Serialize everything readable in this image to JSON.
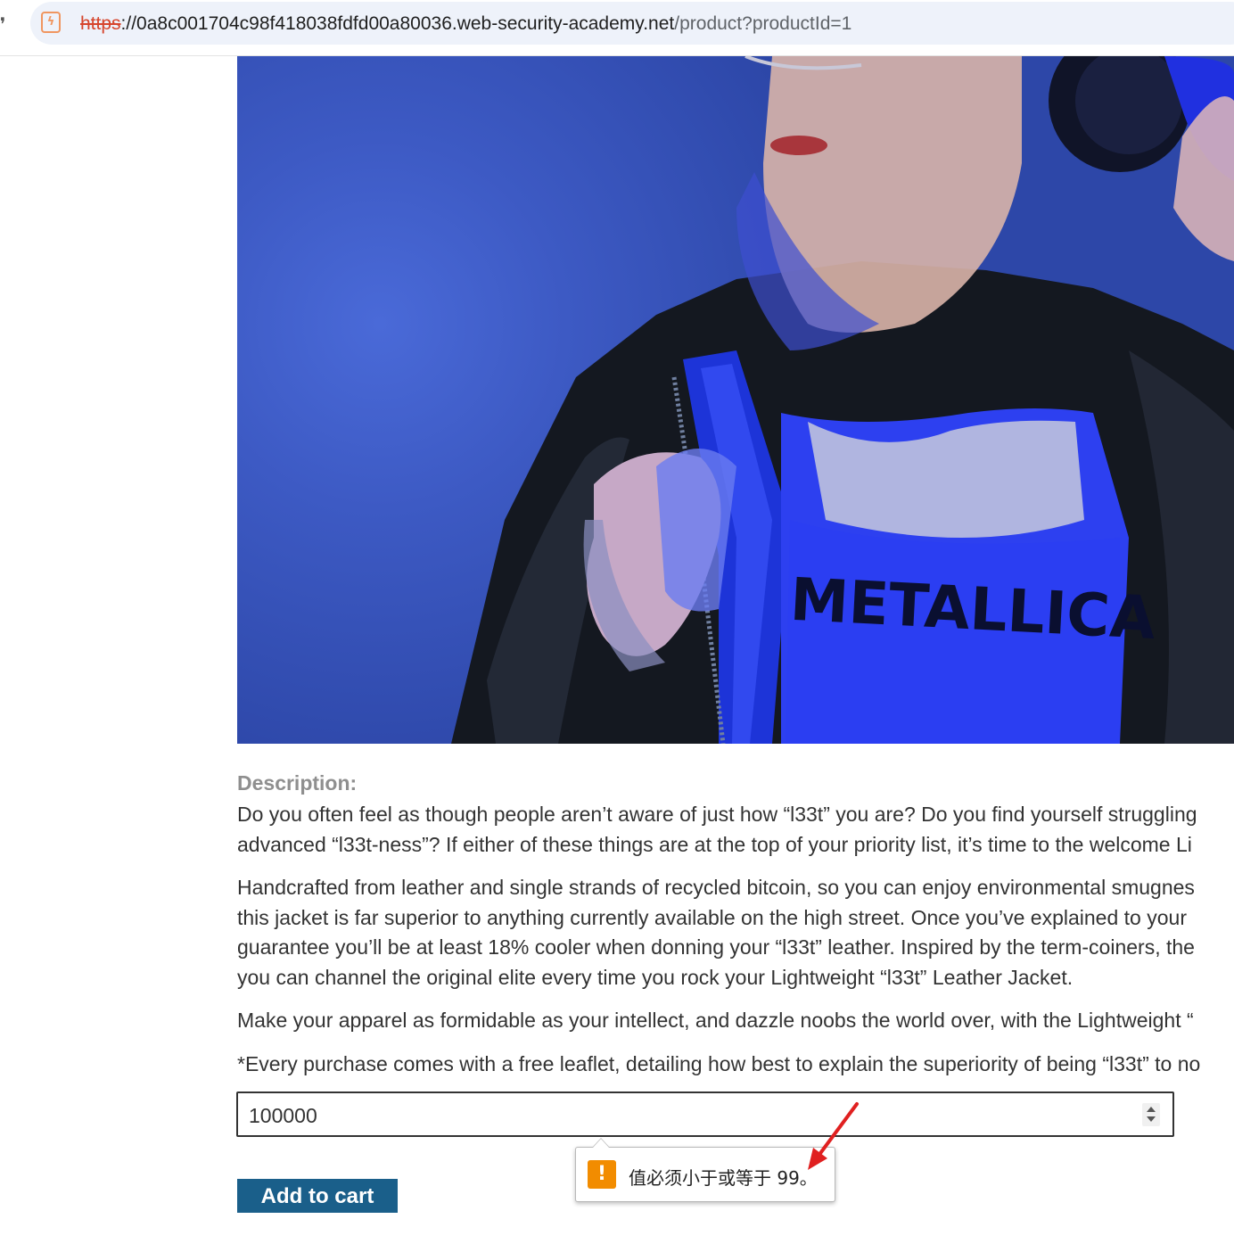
{
  "browser": {
    "url_scheme": "https",
    "url_host": "://0a8c001704c98f418038fdfd00a80036.web-security-academy.net",
    "url_path": "/product?productId=1",
    "site_icon": "not-secure-icon",
    "colors": {
      "scheme_warning": "#d6452c",
      "omnibox_bg": "#eef2fa"
    }
  },
  "product": {
    "image_tshirt_text": "METALLICA",
    "description_heading": "Description:",
    "description_paragraphs": [
      [
        "Do you often feel as though people aren’t aware of just how “l33t” you are? Do you find yourself struggling",
        "advanced “l33t-ness”? If either of these things are at the top of your priority list, it’s time to the welcome Li"
      ],
      [
        "Handcrafted from leather and single strands of recycled bitcoin, so you can enjoy environmental smugnes",
        "this jacket is far superior to anything currently available on the high street. Once you’ve explained to your",
        "guarantee you’ll be at least 18% cooler when donning your “l33t” leather. Inspired by the term-coiners, the",
        "you can channel the original elite every time you rock your Lightweight “l33t” Leather Jacket."
      ],
      [
        "Make your apparel as formidable as your intellect, and dazzle noobs the world over, with the Lightweight “"
      ],
      [
        "*Every purchase comes with a free leaflet, detailing how best to explain the superiority of being “l33t” to no"
      ]
    ]
  },
  "form": {
    "quantity_value": "100000",
    "add_to_cart_label": "Add to cart",
    "validation_message": "值必须小于或等于 99。",
    "validation_icon": "warning-icon",
    "colors": {
      "button_bg": "#1a5f8a",
      "warning": "#f28c00",
      "annotation_arrow": "#e02020"
    }
  }
}
